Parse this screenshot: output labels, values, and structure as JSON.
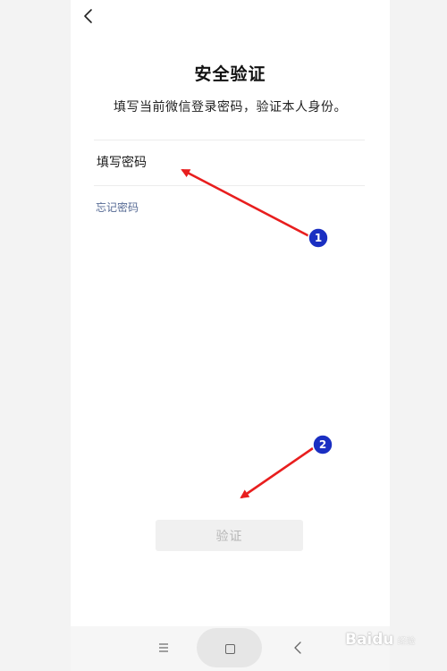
{
  "header": {
    "back_icon": "chevron-left-icon"
  },
  "page": {
    "title": "安全验证",
    "subtitle": "填写当前微信登录密码，验证本人身份。"
  },
  "form": {
    "password_placeholder": "填写密码",
    "password_value": "",
    "forgot_label": "忘记密码",
    "verify_label": "验证"
  },
  "navbar": {
    "menu_icon": "menu-icon",
    "home_icon": "home-square-icon",
    "back_icon": "back-triangle-icon"
  },
  "annotations": {
    "badges": [
      {
        "label": "1"
      },
      {
        "label": "2"
      }
    ],
    "arrow_color": "#e81e1e",
    "badge_color": "#1a2fc2"
  },
  "watermark": {
    "brand": "Baidu",
    "sub": "经验"
  }
}
